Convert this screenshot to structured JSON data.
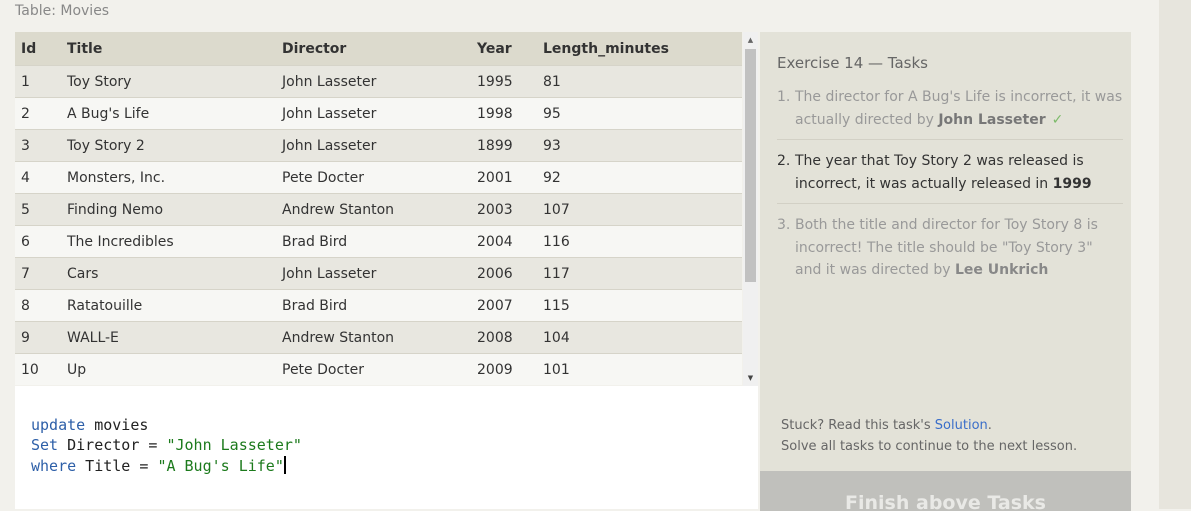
{
  "table": {
    "caption": "Table: Movies",
    "columns": [
      "Id",
      "Title",
      "Director",
      "Year",
      "Length_minutes"
    ],
    "rows": [
      [
        "1",
        "Toy Story",
        "John Lasseter",
        "1995",
        "81"
      ],
      [
        "2",
        "A Bug's Life",
        "John Lasseter",
        "1998",
        "95"
      ],
      [
        "3",
        "Toy Story 2",
        "John Lasseter",
        "1899",
        "93"
      ],
      [
        "4",
        "Monsters, Inc.",
        "Pete Docter",
        "2001",
        "92"
      ],
      [
        "5",
        "Finding Nemo",
        "Andrew Stanton",
        "2003",
        "107"
      ],
      [
        "6",
        "The Incredibles",
        "Brad Bird",
        "2004",
        "116"
      ],
      [
        "7",
        "Cars",
        "John Lasseter",
        "2006",
        "117"
      ],
      [
        "8",
        "Ratatouille",
        "Brad Bird",
        "2007",
        "115"
      ],
      [
        "9",
        "WALL-E",
        "Andrew Stanton",
        "2008",
        "104"
      ],
      [
        "10",
        "Up",
        "Pete Docter",
        "2009",
        "101"
      ]
    ]
  },
  "editor": {
    "line1": {
      "kw": "update",
      "rest": " movies"
    },
    "line2": {
      "kw": "Set",
      "mid": " Director = ",
      "str": "\"John Lasseter\""
    },
    "line3": {
      "kw": "where",
      "mid": " Title = ",
      "str": "\"A Bug's Life\""
    }
  },
  "exercise": {
    "title": "Exercise 14 — Tasks",
    "tasks": [
      {
        "num": "1.",
        "text": "The director for A Bug's Life is incorrect, it was actually directed by ",
        "bold": "John Lasseter",
        "check": "✓",
        "status": "done"
      },
      {
        "num": "2.",
        "text": "The year that Toy Story 2 was released is incorrect, it was actually released in ",
        "bold": "1999",
        "status": "current"
      },
      {
        "num": "3.",
        "text": "Both the title and director for Toy Story 8 is incorrect! The title should be \"Toy Story 3\" and it was directed by ",
        "bold": "Lee Unkrich",
        "status": "pending"
      }
    ],
    "help_prefix": "Stuck? Read this task's ",
    "help_link": "Solution",
    "help_suffix": ".",
    "help_line2": "Solve all tasks to continue to the next lesson.",
    "finish_button": "Finish above Tasks"
  },
  "icons": {
    "scroll_up": "arrow-up",
    "scroll_down": "arrow-down",
    "check": "check"
  },
  "colors": {
    "keyword": "#2d5fa8",
    "string": "#1c7a1c",
    "link": "#3a6ec9",
    "check": "#7dbb6a"
  }
}
